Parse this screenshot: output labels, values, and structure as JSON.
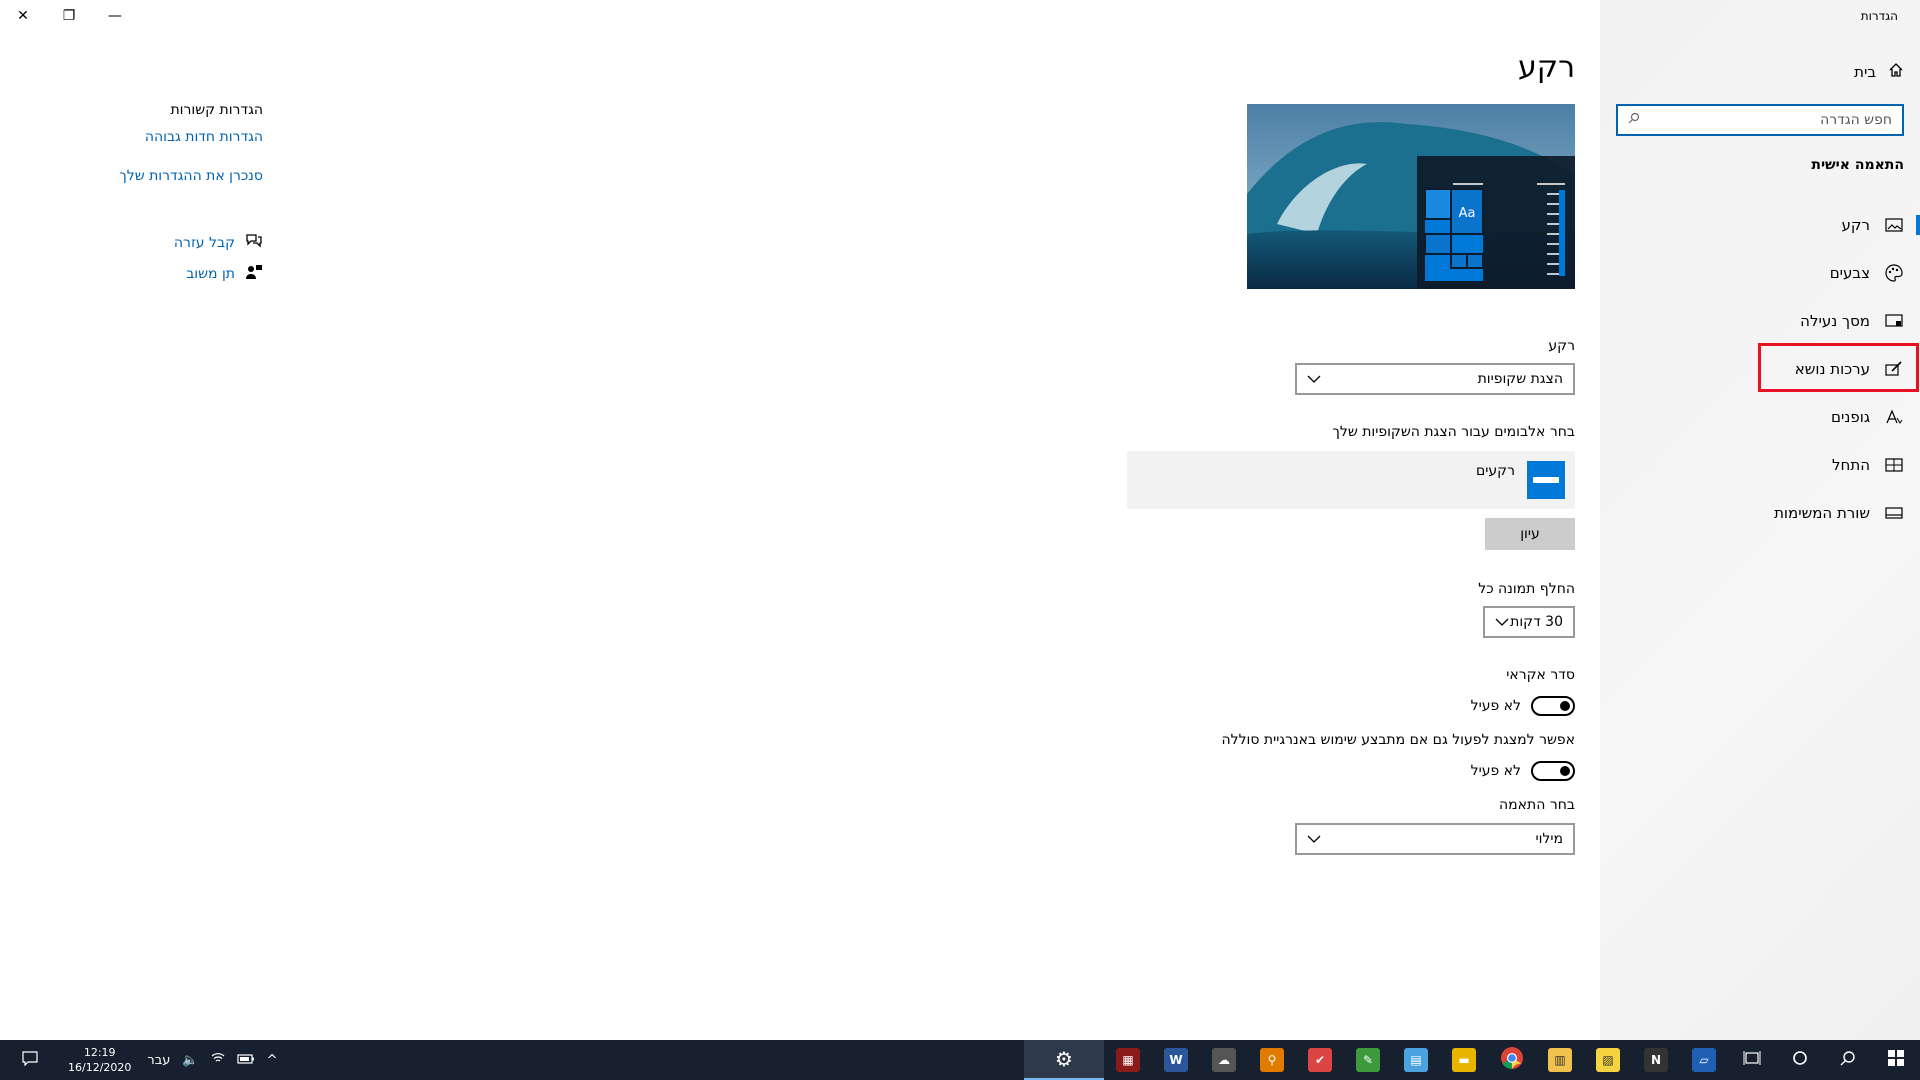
{
  "window": {
    "title": "הגדרות",
    "controls": {
      "close": "✕",
      "maximize": "❐",
      "minimize": "—"
    }
  },
  "nav": {
    "home_label": "בית",
    "search_placeholder": "חפש הגדרה",
    "section_title": "התאמה אישית",
    "items": [
      {
        "label": "רקע",
        "icon": "picture-icon",
        "glyph": "🖼"
      },
      {
        "label": "צבעים",
        "icon": "palette-icon",
        "glyph": "🎨"
      },
      {
        "label": "מסך נעילה",
        "icon": "lock-screen-icon",
        "glyph": "▭"
      },
      {
        "label": "ערכות נושא",
        "icon": "themes-icon",
        "glyph": "✎"
      },
      {
        "label": "גופנים",
        "icon": "fonts-icon",
        "glyph": "A"
      },
      {
        "label": "התחל",
        "icon": "start-icon",
        "glyph": "▦"
      },
      {
        "label": "שורת המשימות",
        "icon": "taskbar-icon",
        "glyph": "▭"
      }
    ]
  },
  "main": {
    "title": "רקע",
    "preview_sample_text": "Aa",
    "background_label": "רקע",
    "background_value": "הצגת שקופיות",
    "albums_label": "בחר אלבומים עבור הצגת השקופיות שלך",
    "album_name": "רקעים",
    "browse_label": "עיון",
    "change_every_label": "החלף תמונה כל",
    "change_every_value": "30 דקות",
    "shuffle_label": "סדר אקראי",
    "shuffle_state": "לא פעיל",
    "battery_label": "אפשר למצגת לפעול גם אם מתבצע שימוש באנרגיית סוללה",
    "battery_state": "לא פעיל",
    "fit_label": "בחר התאמה",
    "fit_value": "מילוי"
  },
  "related": {
    "title": "הגדרות קשורות",
    "link_high_contrast": "הגדרות חדות גבוהה",
    "link_sync": "סנכרן את ההגדרות שלך",
    "help_label": "קבל עזרה",
    "feedback_label": "תן משוב"
  },
  "taskbar": {
    "time": "12:19",
    "date": "16/12/2020",
    "language": "עבר",
    "apps": [
      {
        "icon": "settings-icon",
        "color": "#2e3a4a",
        "glyph": "⚙"
      },
      {
        "icon": "winrar-icon",
        "color": "#8b1a1a",
        "glyph": "▦"
      },
      {
        "icon": "word-icon",
        "color": "#2b579a",
        "glyph": "W"
      },
      {
        "icon": "app-cloud-icon",
        "color": "#555555",
        "glyph": "☁"
      },
      {
        "icon": "search-app-icon",
        "color": "#e07b00",
        "glyph": "⚲"
      },
      {
        "icon": "checklist-icon",
        "color": "#d44",
        "glyph": "✔"
      },
      {
        "icon": "pen-icon",
        "color": "#3c9a3c",
        "glyph": "✎"
      },
      {
        "icon": "notes-icon",
        "color": "#4aa3df",
        "glyph": "▤"
      },
      {
        "icon": "folder-icon",
        "color": "#e8b400",
        "glyph": "▬"
      },
      {
        "icon": "chrome-icon",
        "color": "#db4437",
        "glyph": "◉"
      },
      {
        "icon": "files-icon",
        "color": "#f0c14b",
        "glyph": "▥"
      },
      {
        "icon": "sticky-notes-icon",
        "color": "#f5d33f",
        "glyph": "▨"
      },
      {
        "icon": "nexus-icon",
        "color": "#333333",
        "glyph": "N"
      },
      {
        "icon": "remote-icon",
        "color": "#1e5fb4",
        "glyph": "▱"
      }
    ]
  }
}
